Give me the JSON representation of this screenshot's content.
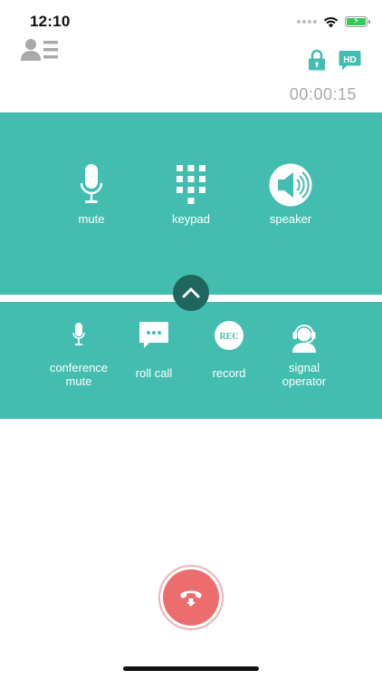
{
  "status_bar": {
    "time": "12:10",
    "icons": [
      "signal-dots-icon",
      "wifi-icon",
      "battery-charging-icon"
    ],
    "battery_color": "#34c759"
  },
  "header": {
    "contact_icon": "contact-card-icon",
    "secure_icon": "lock-icon",
    "hd_badge": "HD",
    "call_timer": "00:00:15"
  },
  "controls": {
    "panel_color": "#43bdb0",
    "primary": [
      {
        "label": "mute",
        "icon": "microphone-icon"
      },
      {
        "label": "keypad",
        "icon": "keypad-icon"
      },
      {
        "label": "speaker",
        "icon": "speaker-icon",
        "active": true
      }
    ],
    "collapse_icon": "chevron-up-icon",
    "secondary": [
      {
        "label": "conference\nmute",
        "icon": "microphone-icon"
      },
      {
        "label": "roll call",
        "icon": "chat-bubble-icon"
      },
      {
        "label": "record",
        "icon": "record-icon",
        "icon_text": "REC"
      },
      {
        "label": "signal\noperator",
        "icon": "operator-headset-icon"
      }
    ]
  },
  "hangup": {
    "icon": "hang-up-icon",
    "color": "#ec6d6d"
  }
}
